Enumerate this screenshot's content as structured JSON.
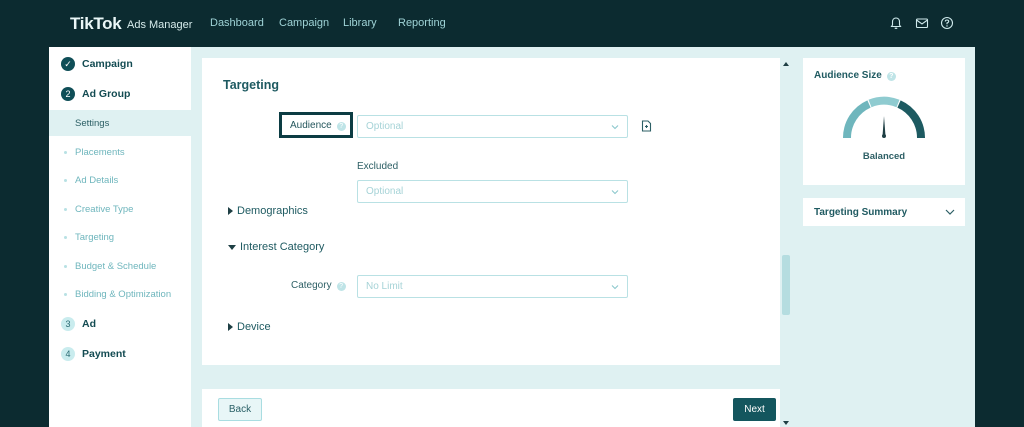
{
  "brand": {
    "name": "TikTok",
    "product": "Ads Manager"
  },
  "nav": [
    "Dashboard",
    "Campaign",
    "Library",
    "Reporting"
  ],
  "top_icons": [
    "bell-icon",
    "inbox-icon",
    "help-circle-icon"
  ],
  "sidebar": {
    "steps": [
      {
        "badge": "✓",
        "label": "Campaign",
        "state": "done"
      },
      {
        "badge": "2",
        "label": "Ad Group",
        "state": "active"
      },
      {
        "badge": "3",
        "label": "Ad",
        "state": "pending"
      },
      {
        "badge": "4",
        "label": "Payment",
        "state": "pending"
      }
    ],
    "sub_items": [
      {
        "label": "Settings",
        "active": true
      },
      {
        "label": "Placements",
        "active": false
      },
      {
        "label": "Ad Details",
        "active": false
      },
      {
        "label": "Creative Type",
        "active": false
      },
      {
        "label": "Targeting",
        "active": false
      },
      {
        "label": "Budget & Schedule",
        "active": false
      },
      {
        "label": "Bidding & Optimization",
        "active": false
      }
    ]
  },
  "targeting": {
    "title": "Targeting",
    "audience_label": "Audience",
    "audience_placeholder": "Optional",
    "excluded_label": "Excluded",
    "excluded_placeholder": "Optional",
    "demographics": "Demographics",
    "interest_category": "Interest Category",
    "category_label": "Category",
    "category_value": "No Limit",
    "device": "Device"
  },
  "footer": {
    "back": "Back",
    "next": "Next"
  },
  "audience_size": {
    "title": "Audience Size",
    "status": "Balanced",
    "level": 0.5
  },
  "targeting_summary": {
    "title": "Targeting Summary"
  },
  "colors": {
    "brand_dark": "#0c2b30",
    "accent": "#14565e",
    "background": "#dff1f2"
  }
}
